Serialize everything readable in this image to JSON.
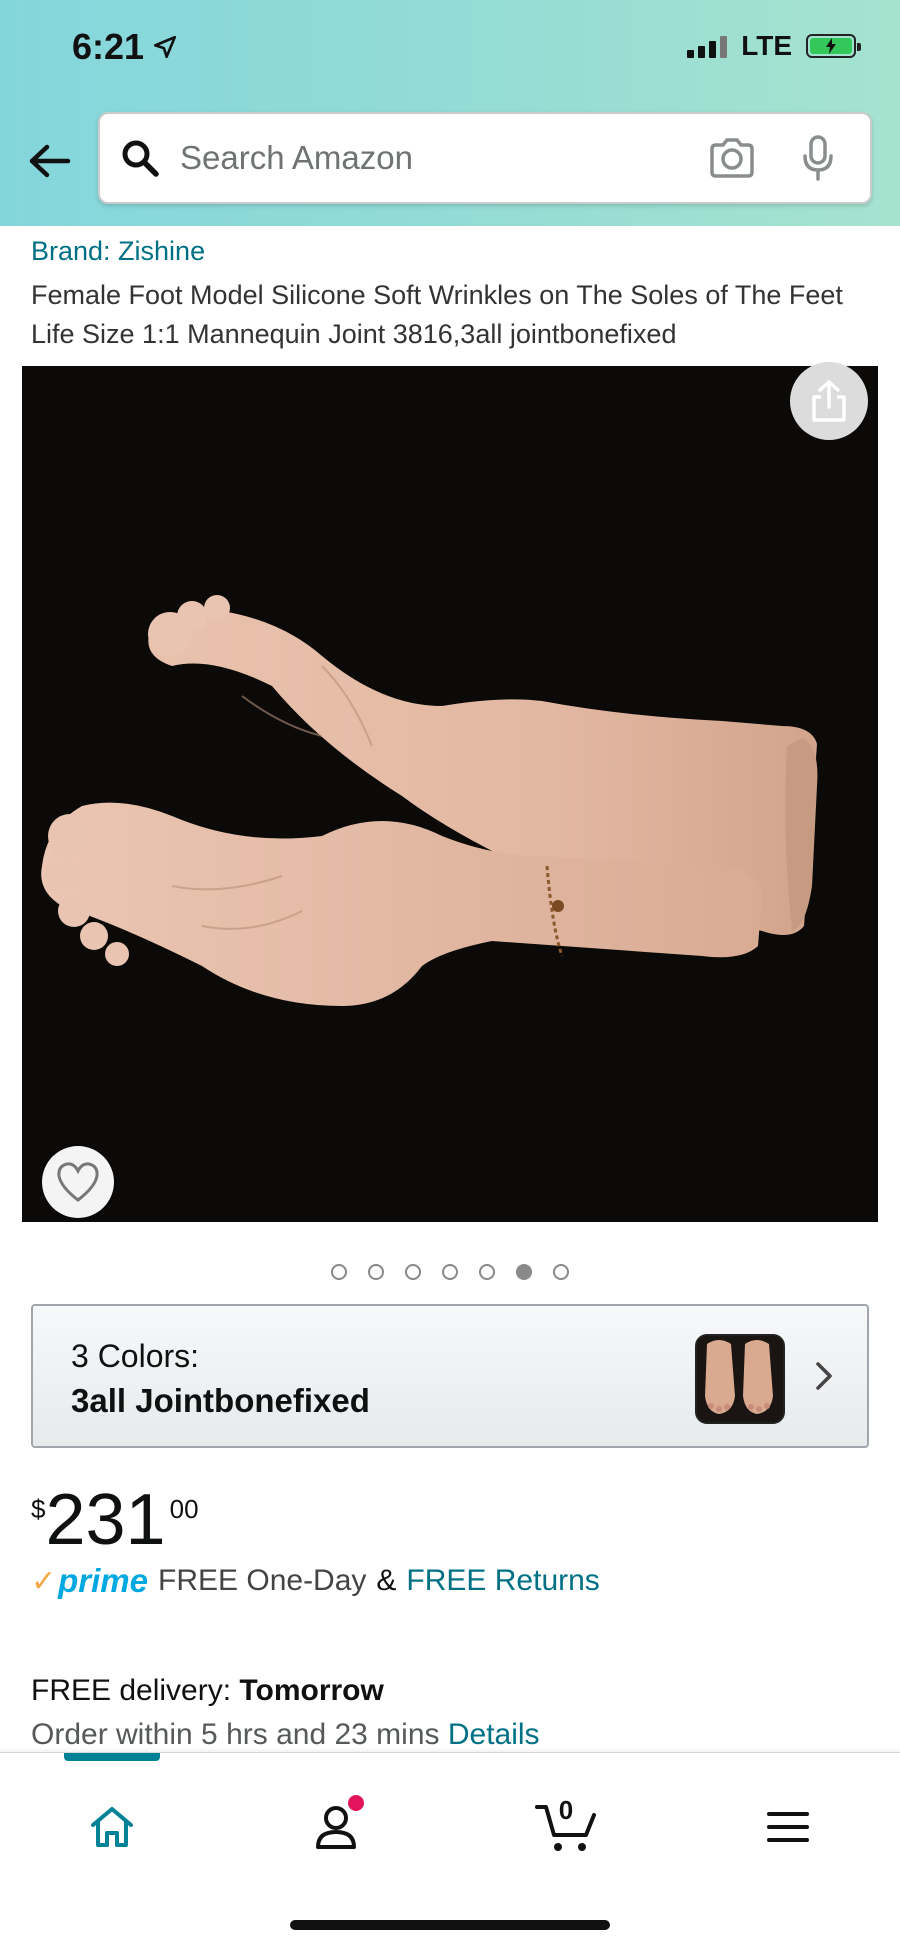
{
  "status_bar": {
    "time": "6:21",
    "network": "LTE"
  },
  "search": {
    "placeholder": "Search Amazon"
  },
  "product": {
    "brand": "Brand: Zishine",
    "title": "Female Foot Model Silicone Soft Wrinkles on The Soles of The Feet Life Size 1:1 Mannequin Joint 3816,3all jointbonefixed",
    "image_count": 7,
    "active_image_index": 5
  },
  "variant": {
    "label": "3 Colors:",
    "value": "3all Jointbonefixed"
  },
  "price": {
    "symbol": "$",
    "whole": "231",
    "fraction": "00"
  },
  "prime": {
    "logo": "prime",
    "shipping": "FREE One-Day",
    "amp": "&",
    "returns": "FREE Returns"
  },
  "delivery": {
    "label": "FREE delivery: ",
    "date": "Tomorrow",
    "order_within": "Order within 5 hrs and 23 mins ",
    "details_link": "Details"
  },
  "bottom_nav": {
    "cart_count": "0"
  },
  "colors": {
    "link": "#007185",
    "prime": "#00a8e1",
    "accent_teal": "#008296"
  }
}
